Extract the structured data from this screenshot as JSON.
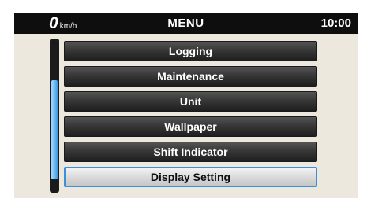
{
  "status_bar": {
    "speed_value": "0",
    "speed_unit": "km/h",
    "title": "MENU",
    "clock": "10:00"
  },
  "menu": {
    "items": [
      {
        "label": "Logging"
      },
      {
        "label": "Maintenance"
      },
      {
        "label": "Unit"
      },
      {
        "label": "Wallpaper"
      },
      {
        "label": "Shift Indicator"
      },
      {
        "label": "Display Setting"
      }
    ],
    "selected_label": "Display Setting"
  },
  "scroll": {
    "position_fraction": 0.55,
    "visible_fraction": 0.64
  },
  "colors": {
    "screen_background": "#ede8dd",
    "top_bar": "#0e0e0e",
    "button_dark": "#2e2e2e",
    "button_selected": "#dcdcdc",
    "selection_border": "#3c8fd8",
    "scroll_thumb": "#6dbbf5"
  }
}
